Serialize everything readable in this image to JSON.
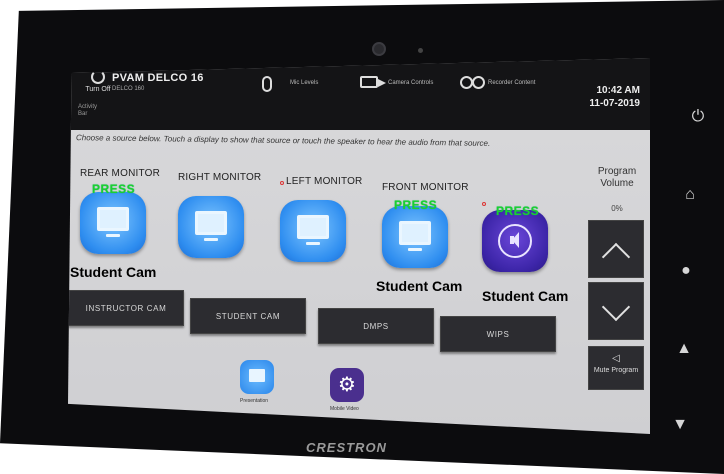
{
  "header": {
    "turn_off_label": "Turn Off",
    "room_name": "PVAM DELCO 16",
    "room_sub": "DELCO 160",
    "activity_label": "Activity",
    "activity_value": "Bar",
    "mic_label": "Mic Levels",
    "camera_label": "Camera Controls",
    "recorder_label": "Recorder Content",
    "time": "10:42 AM",
    "date": "11-07-2019"
  },
  "instructions": "Choose a source below. Touch a display to show that source or touch the speaker to hear the audio from that source.",
  "displays": [
    {
      "label": "REAR MONITOR",
      "press": "PRESS",
      "source": "Student Cam"
    },
    {
      "label": "RIGHT MONITOR",
      "press": "",
      "source": ""
    },
    {
      "label": "LEFT MONITOR",
      "press": "",
      "source": ""
    },
    {
      "label": "FRONT MONITOR",
      "press": "PRESS",
      "source": "Student Cam"
    },
    {
      "label": "",
      "press": "PRESS",
      "source": "Student Cam"
    }
  ],
  "sources": [
    "INSTRUCTOR CAM",
    "STUDENT CAM",
    "DMPS",
    "WIPS"
  ],
  "volume": {
    "title": "Program Volume",
    "value": "0%",
    "mute_label": "Mute Program"
  },
  "bottom_nav": {
    "presentation_label": "Presentation",
    "mobile_label": "Mobile Video"
  },
  "brand": "CRESTRON",
  "icons": {
    "side": [
      "power-icon",
      "home-icon",
      "light-icon",
      "up-arrow-icon",
      "down-arrow-icon"
    ]
  },
  "colors": {
    "press_text": "#1bd12e",
    "display_button": "#2f8ef0",
    "speaker_button": "#3c25a8",
    "source_button": "#2c2c30"
  }
}
